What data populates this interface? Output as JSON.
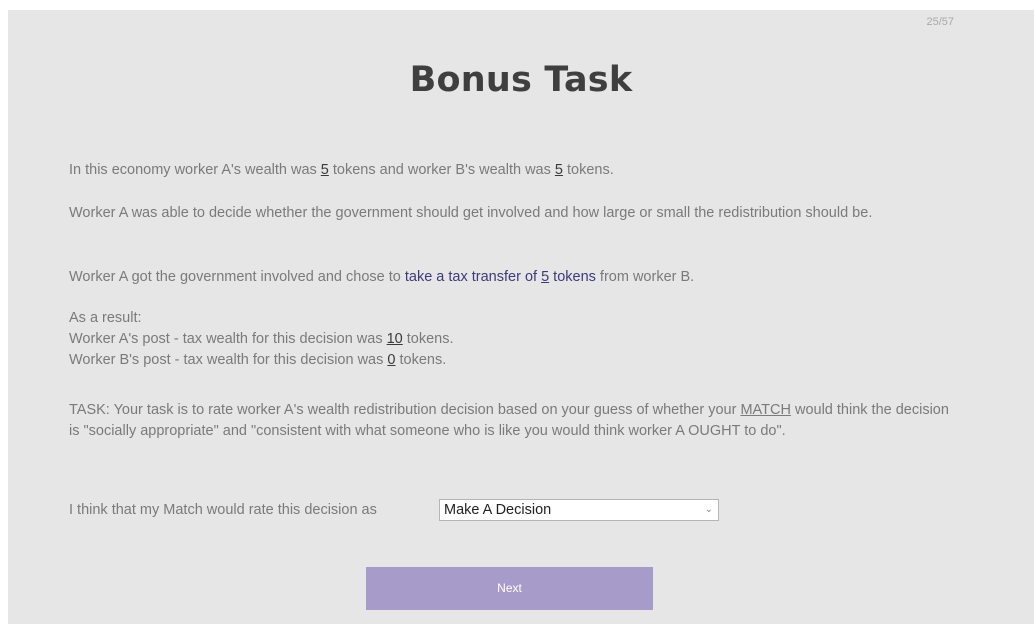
{
  "progress": "25/57",
  "title": "Bonus Task",
  "p1": {
    "a": "In this economy worker A's wealth was ",
    "a_val": "5",
    "b": " tokens and worker B's wealth was ",
    "b_val": "5",
    "c": " tokens."
  },
  "p2": "Worker A was able to decide whether the government should get involved and how large or small the redistribution should be.",
  "p3": {
    "a": "Worker A got the government involved and chose to ",
    "link_a": "take a tax transfer of ",
    "link_val": "5",
    "link_b": " tokens",
    "b": " from worker B."
  },
  "p4": {
    "line1": "As a result:",
    "line2_a": "Worker A's post - tax wealth for this decision was ",
    "line2_val": "10",
    "line2_b": " tokens.",
    "line3_a": "Worker B's post - tax wealth for this decision was ",
    "line3_val": "0",
    "line3_b": " tokens."
  },
  "p5": {
    "a": "TASK: Your task is to rate worker A's wealth redistribution decision based on your guess of whether your ",
    "match": "MATCH",
    "b": " would think the decision is \"socially appropriate\" and \"consistent with what someone who is like you would think worker A OUGHT to do\"."
  },
  "p6": "I think that my Match would rate this decision as",
  "select": {
    "value": "Make A Decision",
    "chevron": "⌄"
  },
  "next_label": "Next"
}
